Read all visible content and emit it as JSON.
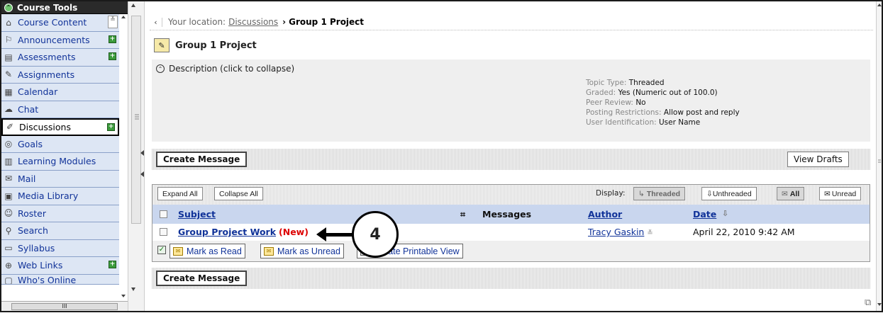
{
  "sidebar": {
    "header": "Course Tools",
    "items": [
      {
        "label": "Course Content",
        "icon": "home-icon",
        "plus": false
      },
      {
        "label": "Announcements",
        "icon": "announcement-icon",
        "plus": true
      },
      {
        "label": "Assessments",
        "icon": "assessment-icon",
        "plus": true
      },
      {
        "label": "Assignments",
        "icon": "assignment-icon",
        "plus": false
      },
      {
        "label": "Calendar",
        "icon": "calendar-icon",
        "plus": false
      },
      {
        "label": "Chat",
        "icon": "chat-icon",
        "plus": false
      },
      {
        "label": "Discussions",
        "icon": "pushpin-icon",
        "plus": true
      },
      {
        "label": "Goals",
        "icon": "goals-icon",
        "plus": false
      },
      {
        "label": "Learning Modules",
        "icon": "modules-icon",
        "plus": false
      },
      {
        "label": "Mail",
        "icon": "mail-icon",
        "plus": false
      },
      {
        "label": "Media Library",
        "icon": "media-icon",
        "plus": false
      },
      {
        "label": "Roster",
        "icon": "roster-icon",
        "plus": false
      },
      {
        "label": "Search",
        "icon": "search-icon",
        "plus": false
      },
      {
        "label": "Syllabus",
        "icon": "syllabus-icon",
        "plus": false
      },
      {
        "label": "Web Links",
        "icon": "web-icon",
        "plus": true
      },
      {
        "label": "Who's Online",
        "icon": "online-icon",
        "plus": false
      }
    ],
    "scroll_thumb": "III"
  },
  "breadcrumb": {
    "prefix": "Your location:",
    "link": "Discussions",
    "separator": "›",
    "current": "Group 1 Project"
  },
  "page_title": "Group 1 Project",
  "description": {
    "toggle": "Description (click to collapse)",
    "properties": [
      {
        "label": "Topic Type:",
        "value": "Threaded"
      },
      {
        "label": "Graded:",
        "value": "Yes (Numeric out of 100.0)"
      },
      {
        "label": "Peer Review:",
        "value": "No"
      },
      {
        "label": "Posting Restrictions:",
        "value": "Allow post and reply"
      },
      {
        "label": "User Identification:",
        "value": "User Name"
      }
    ]
  },
  "buttons": {
    "create_message": "Create Message",
    "view_drafts": "View Drafts",
    "expand_all": "Expand All",
    "collapse_all": "Collapse All",
    "display_label": "Display:",
    "threaded": "Threaded",
    "unthreaded": "Unthreaded",
    "all": "All",
    "unread": "Unread"
  },
  "table": {
    "headers": {
      "subject": "Subject",
      "messages": "Messages",
      "author": "Author",
      "date": "Date"
    },
    "rows": [
      {
        "subject": "Group Project Work",
        "badge": "(New)",
        "author": "Tracy Gaskin",
        "date": "April 22, 2010 9:42 AM"
      }
    ]
  },
  "actions": {
    "mark_read": "Mark as Read",
    "mark_unread": "Mark as Unread",
    "printable": "Create Printable View"
  },
  "callout": "4"
}
